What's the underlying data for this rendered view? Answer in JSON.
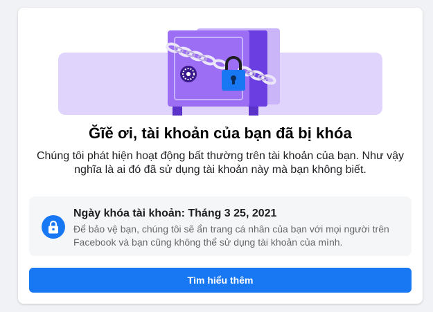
{
  "card": {
    "title": "Ğĩě ơi, tài khoản của bạn đã bị khóa",
    "description": "Chúng tôi phát hiện hoạt động bất thường trên tài khoản của bạn. Như vậy nghĩa là ai đó đã sử dụng tài khoản này mà bạn không biết."
  },
  "info": {
    "icon": "lock-icon",
    "title": "Ngày khóa tài khoản: Tháng 3 25, 2021",
    "subtitle": "Để bảo vệ bạn, chúng tôi sẽ ẩn trang cá nhân của bạn với mọi người trên Facebook và bạn cũng không thể sử dụng tài khoản của mình."
  },
  "button": {
    "label": "Tìm hiểu thêm"
  },
  "colors": {
    "accent": "#1877f2",
    "illustration_bg": "#e4dcfb",
    "safe_body": "#8b5cf6"
  }
}
